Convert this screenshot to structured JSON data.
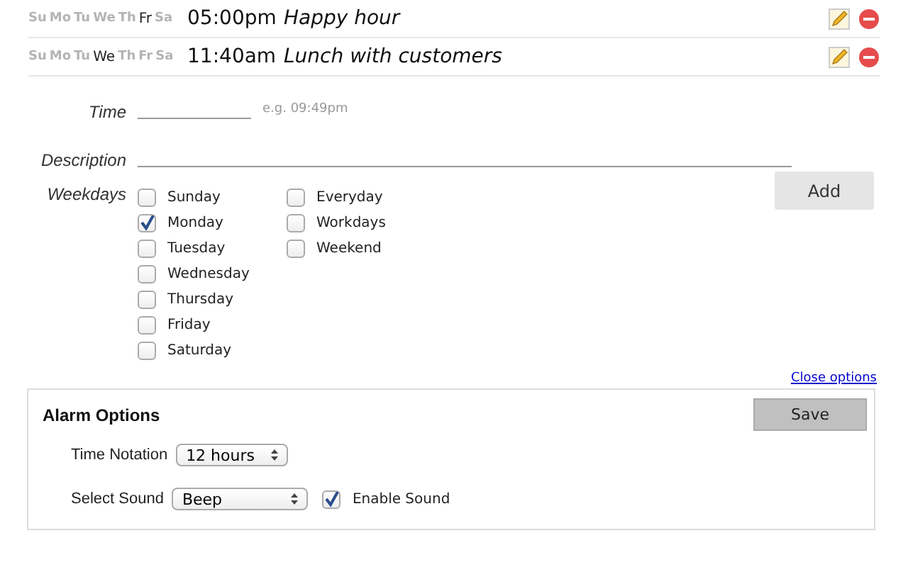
{
  "alarms": [
    {
      "days": [
        {
          "label": "Su",
          "selected": false
        },
        {
          "label": "Mo",
          "selected": false
        },
        {
          "label": "Tu",
          "selected": false
        },
        {
          "label": "We",
          "selected": false
        },
        {
          "label": "Th",
          "selected": false
        },
        {
          "label": "Fr",
          "selected": true
        },
        {
          "label": "Sa",
          "selected": false
        }
      ],
      "time": "05:00pm",
      "description": "Happy hour"
    },
    {
      "days": [
        {
          "label": "Su",
          "selected": false
        },
        {
          "label": "Mo",
          "selected": false
        },
        {
          "label": "Tu",
          "selected": false
        },
        {
          "label": "We",
          "selected": true
        },
        {
          "label": "Th",
          "selected": false
        },
        {
          "label": "Fr",
          "selected": false
        },
        {
          "label": "Sa",
          "selected": false
        }
      ],
      "time": "11:40am",
      "description": "Lunch with customers"
    }
  ],
  "form": {
    "time_label": "Time",
    "time_hint": "e.g. 09:49pm",
    "description_label": "Description",
    "weekdays_label": "Weekdays",
    "weekdays": [
      {
        "label": "Sunday",
        "checked": false
      },
      {
        "label": "Monday",
        "checked": true
      },
      {
        "label": "Tuesday",
        "checked": false
      },
      {
        "label": "Wednesday",
        "checked": false
      },
      {
        "label": "Thursday",
        "checked": false
      },
      {
        "label": "Friday",
        "checked": false
      },
      {
        "label": "Saturday",
        "checked": false
      }
    ],
    "presets": [
      {
        "label": "Everyday",
        "checked": false
      },
      {
        "label": "Workdays",
        "checked": false
      },
      {
        "label": "Weekend",
        "checked": false
      }
    ],
    "add_button": "Add"
  },
  "close_options": "Close options",
  "alarm_options": {
    "title": "Alarm Options",
    "save_button": "Save",
    "time_notation_label": "Time Notation",
    "time_notation": "12 hours",
    "sound_label": "Select Sound",
    "sound": "Beep",
    "enable_sound": {
      "label": "Enable Sound",
      "checked": true
    }
  }
}
